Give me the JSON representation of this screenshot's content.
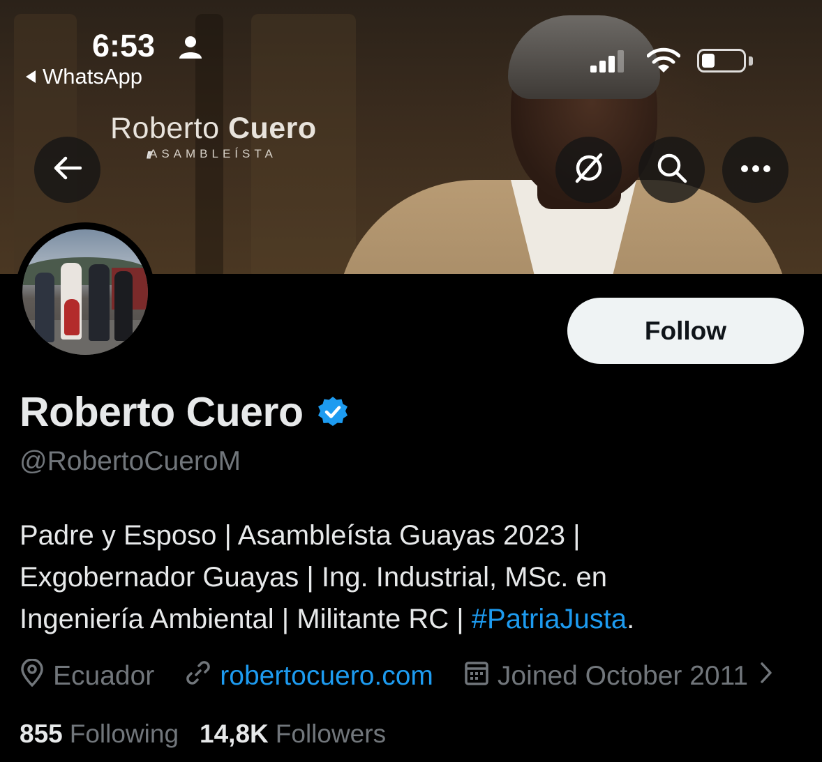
{
  "status_bar": {
    "time": "6:53",
    "back_app": "WhatsApp",
    "icons": [
      "person-icon",
      "signal-icon",
      "wifi-icon",
      "battery-icon"
    ]
  },
  "banner": {
    "name_regular": "Roberto",
    "name_bold": "Cuero",
    "subtitle": "ASAMBLEÍSTA",
    "logo_mark": "///"
  },
  "header_buttons": {
    "back_icon": "arrow-left-icon",
    "grok_icon": "grok-icon",
    "search_icon": "search-icon",
    "more_icon": "more-icon"
  },
  "profile": {
    "follow_label": "Follow",
    "display_name": "Roberto Cuero",
    "handle": "@RobertoCueroM",
    "bio_lines": [
      "Padre y Esposo | Asambleísta Guayas 2023 |",
      "Exgobernador Guayas | Ing. Industrial, MSc. en",
      "Ingeniería Ambiental | Militante RC | "
    ],
    "bio_hashtag": "#PatriaJusta",
    "bio_end": ".",
    "location": "Ecuador",
    "website": "robertocuero.com",
    "joined": "Joined October 2011",
    "following_count": "855",
    "following_label": "Following",
    "followers_count": "14,8K",
    "followers_label": "Followers"
  },
  "colors": {
    "accent": "#1d9bf0",
    "text_primary": "#e7e9ea",
    "text_secondary": "#71767b",
    "background": "#000000",
    "follow_bg": "#eff3f4"
  }
}
